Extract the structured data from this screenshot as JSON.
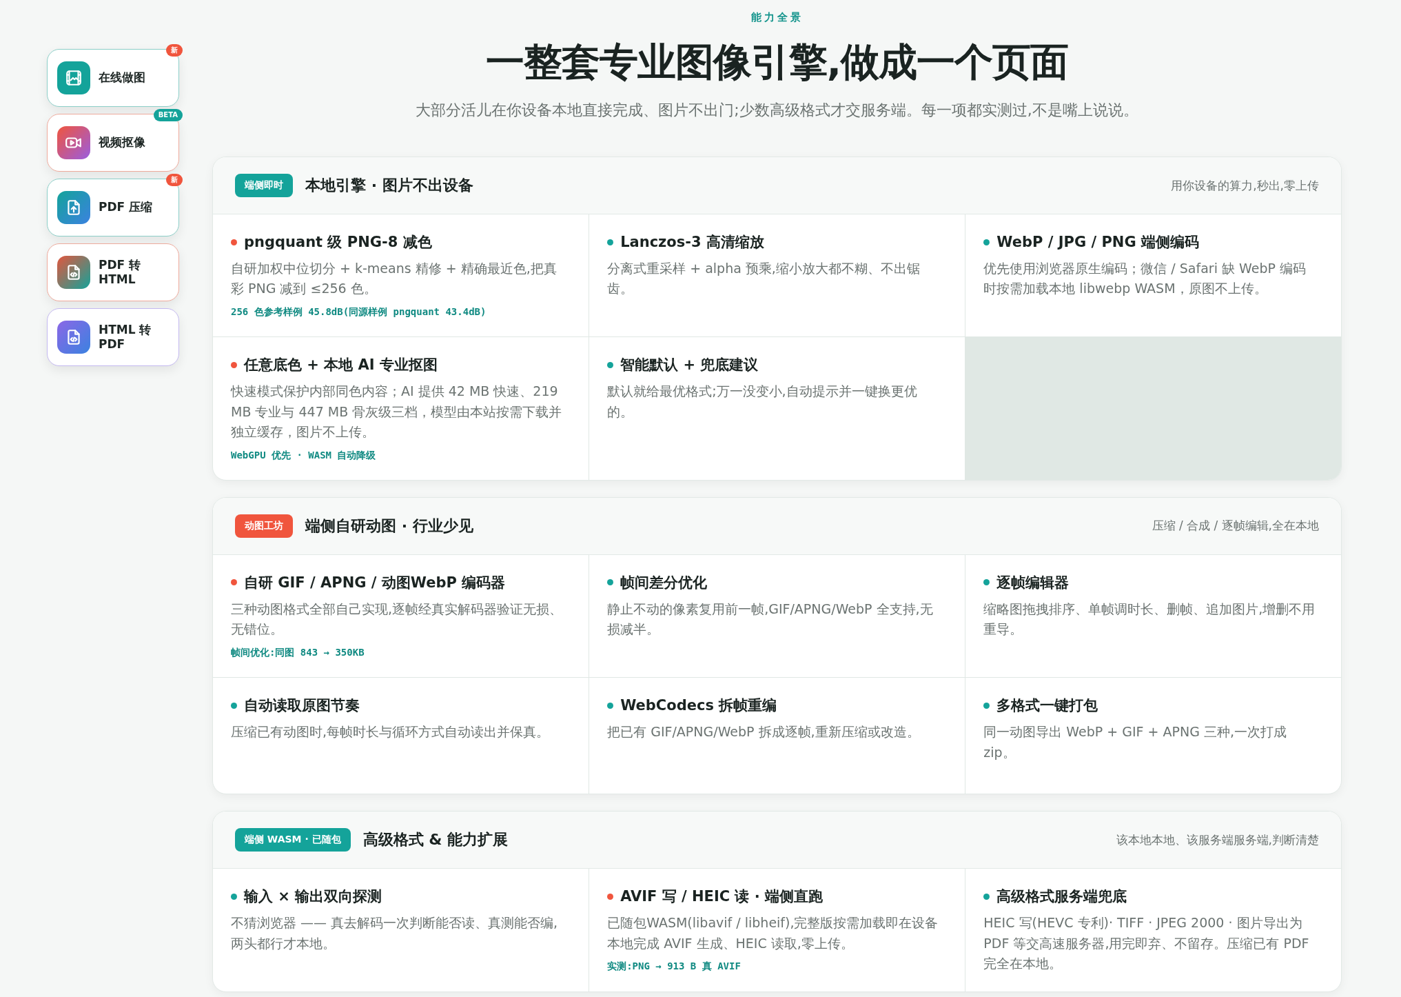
{
  "sidebar": {
    "items": [
      {
        "label": "在线做图",
        "kind": "image-editor",
        "badge": {
          "text": "新",
          "kind": "new"
        }
      },
      {
        "label": "视频抠像",
        "kind": "video",
        "badge": {
          "text": "BETA",
          "kind": "beta"
        }
      },
      {
        "label": "PDF 压缩",
        "kind": "pdf-compress",
        "badge": {
          "text": "新",
          "kind": "new"
        }
      },
      {
        "label": "PDF 转 HTML",
        "kind": "pdf-html"
      },
      {
        "label": "HTML 转 PDF",
        "kind": "html-pdf"
      }
    ]
  },
  "header": {
    "kicker": "能力全景",
    "title": "一整套专业图像引擎,做成一个页面",
    "subtitle": "大部分活儿在你设备本地直接完成、图片不出门;少数高级格式才交服务端。每一项都实测过,不是嘴上说说。"
  },
  "sections": [
    {
      "tag": "端侧即时",
      "color": "#14a39a",
      "title": "本地引擎 · 图片不出设备",
      "aside": "用你设备的算力,秒出,零上传",
      "features": [
        {
          "title": "pngquant 级 PNG-8 减色",
          "color": "#f0553d",
          "description": "自研加权中位切分 + k-means 精修 + 精确最近色,把真彩 PNG 减到 ≤256 色。",
          "note": "256 色参考样例 45.8dB(同源样例 pngquant 43.4dB)"
        },
        {
          "title": "Lanczos-3 高清缩放",
          "color": "#14a39a",
          "description": "分离式重采样 + alpha 预乘,缩小放大都不糊、不出锯齿。"
        },
        {
          "title": "WebP / JPG / PNG 端侧编码",
          "color": "#14a39a",
          "description": "优先使用浏览器原生编码；微信 / Safari 缺 WebP 编码时按需加载本地 libwebp WASM，原图不上传。"
        },
        {
          "title": "任意底色 + 本地 AI 专业抠图",
          "color": "#f0553d",
          "description": "快速模式保护内部同色内容；AI 提供 42 MB 快速、219 MB 专业与 447 MB 骨灰级三档，模型由本站按需下载并独立缓存，图片不上传。",
          "note": "WebGPU 优先 · WASM 自动降级"
        },
        {
          "title": "智能默认 + 兜底建议",
          "color": "#14a39a",
          "description": "默认就给最优格式;万一没变小,自动提示并一键换更优的。"
        }
      ]
    },
    {
      "tag": "动图工坊",
      "color": "#f0553d",
      "title": "端侧自研动图 · 行业少见",
      "aside": "压缩 / 合成 / 逐帧编辑,全在本地",
      "features": [
        {
          "title": "自研 GIF / APNG / 动图WebP 编码器",
          "color": "#f0553d",
          "description": "三种动图格式全部自己实现,逐帧经真实解码器验证无损、无错位。",
          "note": "帧间优化:同图 843 → 350KB"
        },
        {
          "title": "帧间差分优化",
          "color": "#14a39a",
          "description": "静止不动的像素复用前一帧,GIF/APNG/WebP 全支持,无损减半。"
        },
        {
          "title": "逐帧编辑器",
          "color": "#14a39a",
          "description": "缩略图拖拽排序、单帧调时长、删帧、追加图片,增删不用重导。"
        },
        {
          "title": "自动读取原图节奏",
          "color": "#14a39a",
          "description": "压缩已有动图时,每帧时长与循环方式自动读出并保真。"
        },
        {
          "title": "WebCodecs 拆帧重编",
          "color": "#14a39a",
          "description": "把已有 GIF/APNG/WebP 拆成逐帧,重新压缩或改造。"
        },
        {
          "title": "多格式一键打包",
          "color": "#14a39a",
          "description": "同一动图导出 WebP + GIF + APNG 三种,一次打成 zip。"
        }
      ]
    },
    {
      "tag": "端侧 WASM · 已随包",
      "color": "#14a39a",
      "title": "高级格式 & 能力扩展",
      "aside": "该本地本地、该服务端服务端,判断清楚",
      "features": [
        {
          "title": "输入 × 输出双向探测",
          "color": "#14a39a",
          "description": "不猜浏览器 —— 真去解码一次判断能否读、真测能否编,两头都行才本地。"
        },
        {
          "title": "AVIF 写 / HEIC 读 · 端侧直跑",
          "color": "#f0553d",
          "description": "已随包WASM(libavif / libheif),完整版按需加载即在设备本地完成 AVIF 生成、HEIC 读取,零上传。",
          "note": "实测:PNG → 913 B 真 AVIF"
        },
        {
          "title": "高级格式服务端兜底",
          "color": "#14a39a",
          "description": "HEIC 写(HEVC 专利)· TIFF · JPEG 2000 · 图片导出为 PDF 等交高速服务器,用完即弃、不留存。压缩已有 PDF 完全在本地。"
        }
      ]
    }
  ]
}
